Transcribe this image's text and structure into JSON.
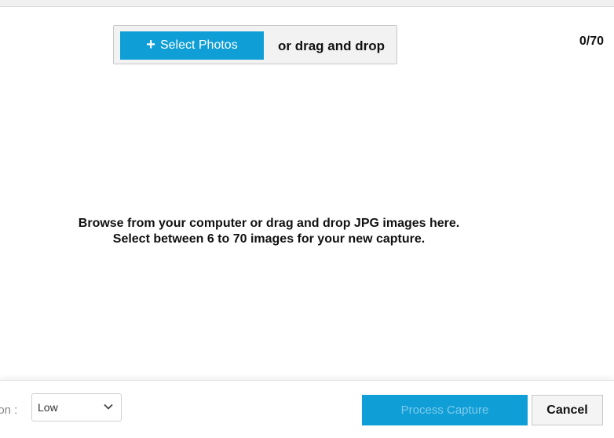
{
  "upload": {
    "select_label": "Select Photos",
    "drag_label": "or drag and drop",
    "counter": "0/70"
  },
  "instructions": {
    "line1": "Browse from your computer or drag and drop JPG images here.",
    "line2": "Select between 6 to 70 images for your new capture."
  },
  "footer": {
    "quality_label": "ion :",
    "quality_value": "Low",
    "process_label": "Process Capture",
    "cancel_label": "Cancel"
  },
  "colors": {
    "accent": "#0f9fd6"
  }
}
